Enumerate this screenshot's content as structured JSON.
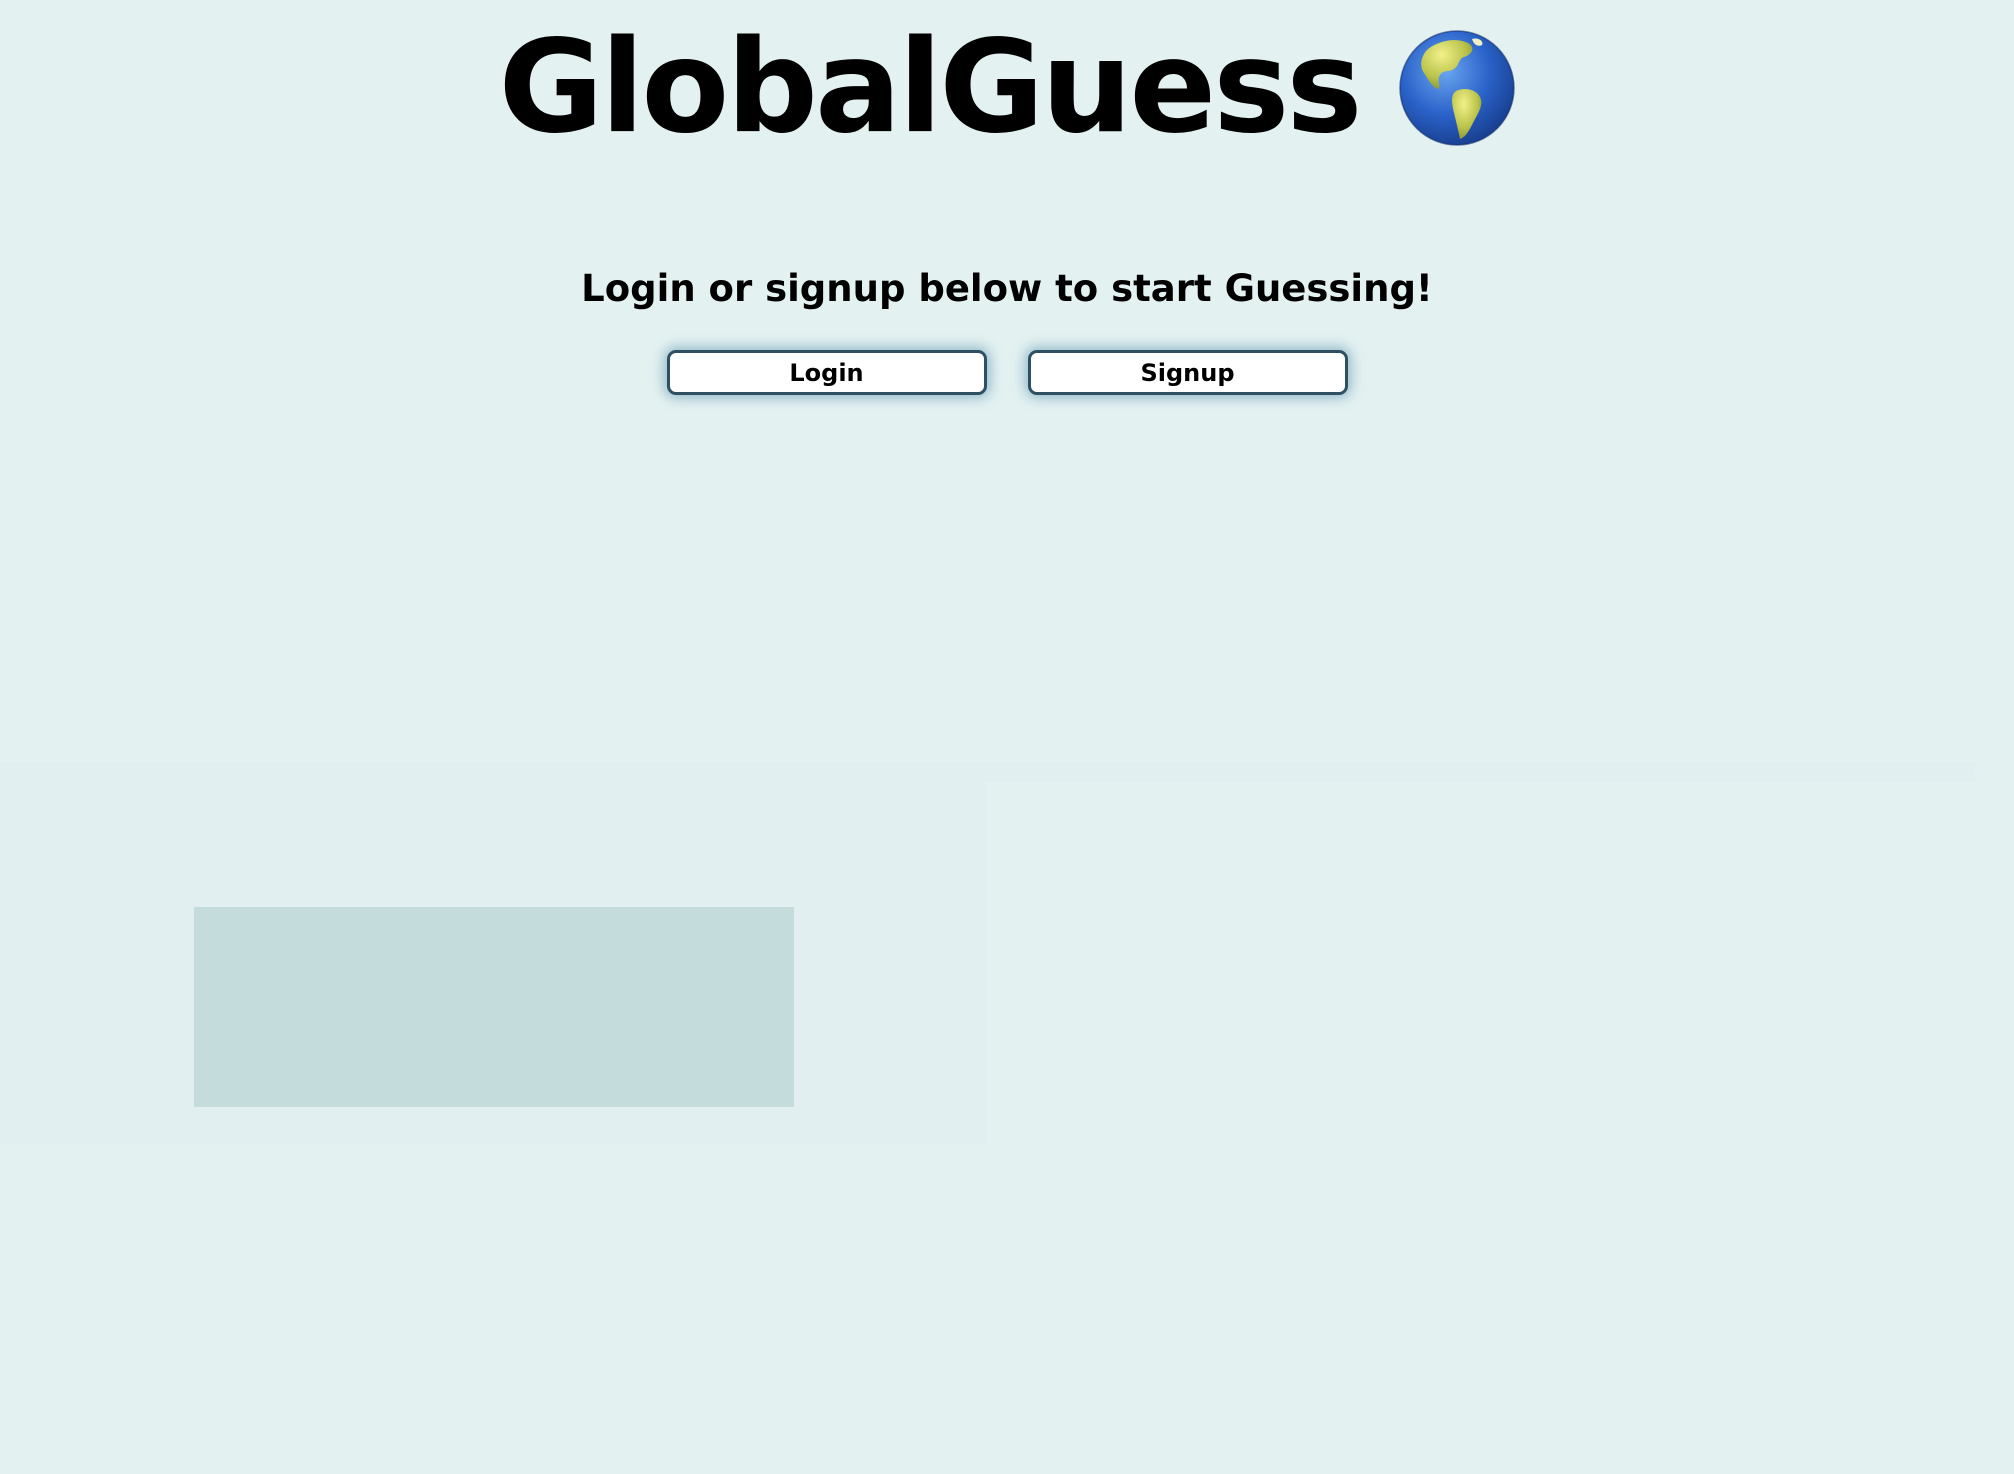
{
  "header": {
    "title": "GlobalGuess",
    "logo_icon": "globe-americas-icon"
  },
  "main": {
    "tagline": "Login or signup below to start Guessing!",
    "login_label": "Login",
    "signup_label": "Signup"
  },
  "colors": {
    "background": "#e3f1f1",
    "button_border": "#2f4f63",
    "button_bg": "#ffffff",
    "placeholder_box": "#c5dcdd"
  }
}
